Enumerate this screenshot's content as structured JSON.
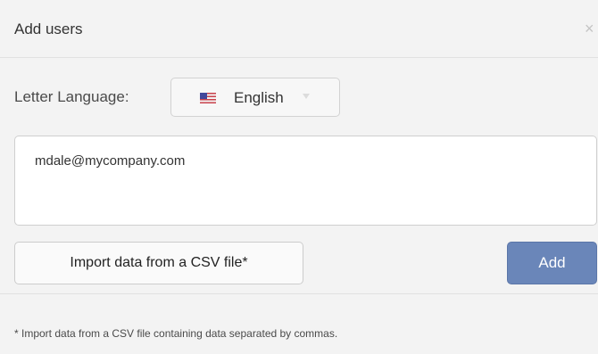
{
  "dialog": {
    "title": "Add users",
    "close_icon": "close-icon",
    "close_glyph": "×"
  },
  "language": {
    "label": "Letter Language:",
    "selected": "English",
    "flag_icon": "us-flag-icon",
    "caret_icon": "chevron-down-icon"
  },
  "emails": {
    "value": "mdale@mycompany.com"
  },
  "actions": {
    "import_label": "Import data from a CSV file*",
    "add_label": "Add"
  },
  "footer": {
    "note": "* Import data from a CSV file containing data separated by commas."
  },
  "colors": {
    "accent": "#6a86b9",
    "background": "#f3f3f3",
    "border": "#cfcfcf"
  }
}
